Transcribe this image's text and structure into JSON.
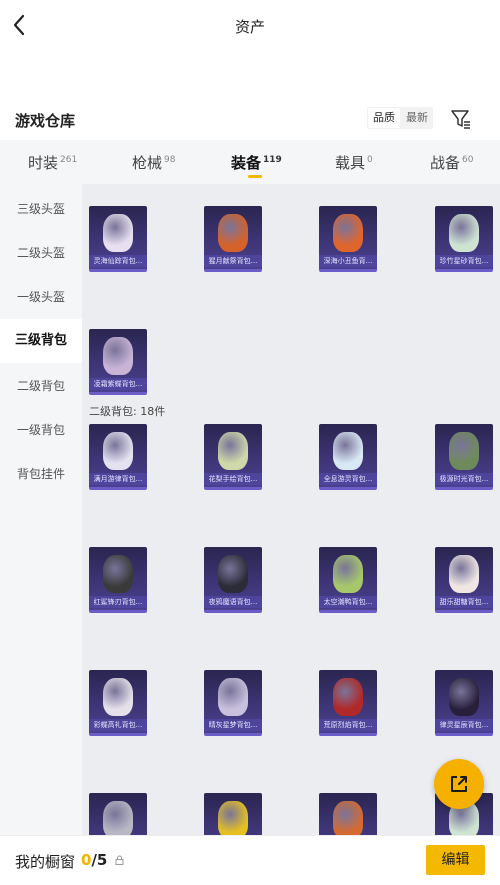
{
  "header": {
    "title": "资产"
  },
  "warehouse": {
    "title": "游戏仓库",
    "sort_options": [
      "品质",
      "最新"
    ],
    "sort_selected": "品质"
  },
  "tabs": [
    {
      "label": "时装",
      "count": "261"
    },
    {
      "label": "枪械",
      "count": "98"
    },
    {
      "label": "装备",
      "count": "119"
    },
    {
      "label": "载具",
      "count": "0"
    },
    {
      "label": "战备",
      "count": "60"
    }
  ],
  "active_tab": "装备",
  "sidebar": [
    "三级头盔",
    "二级头盔",
    "一级头盔",
    "三级背包",
    "二级背包",
    "一级背包",
    "背包挂件"
  ],
  "active_sidebar": "三级背包",
  "sections": [
    {
      "label": "",
      "items": [
        {
          "name": "灵海仙踪背包...",
          "color": "#e8e0f0"
        },
        {
          "name": "猩月献祭背包...",
          "color": "#d4622a"
        },
        {
          "name": "深海小丑鱼背...",
          "color": "#e0652c"
        },
        {
          "name": "珍竹星砂背包...",
          "color": "#cfe3d2"
        },
        {
          "name": "凌霜紫蝶背包...",
          "color": "#c9b4d6"
        }
      ]
    },
    {
      "label": "二级背包: 18件",
      "items": [
        {
          "name": "满月游律背包...",
          "color": "#e4e2f0"
        },
        {
          "name": "花梨手绘背包...",
          "color": "#cfd8a8"
        },
        {
          "name": "全息游灵背包...",
          "color": "#d8e8f4"
        },
        {
          "name": "极源时光背包...",
          "color": "#6f8a5a"
        },
        {
          "name": "红鲨锋刃背包...",
          "color": "#3a3a3a"
        },
        {
          "name": "夜鸦魔语背包...",
          "color": "#2c2c38"
        },
        {
          "name": "太空潮鸭背包...",
          "color": "#a6c86a"
        },
        {
          "name": "甜乐甜糖背包...",
          "color": "#f0e6e4"
        },
        {
          "name": "彩蝶高礼背包...",
          "color": "#e6e0ea"
        },
        {
          "name": "晴灰星梦背包...",
          "color": "#c8c0dc"
        },
        {
          "name": "荒原烈焰背包...",
          "color": "#b02828"
        },
        {
          "name": "律灵星辰背包...",
          "color": "#28203a"
        },
        {
          "name": "",
          "color": "#b8b8c4"
        },
        {
          "name": "",
          "color": "#e6c020"
        },
        {
          "name": "",
          "color": "#d46a30"
        },
        {
          "name": "",
          "color": "#cfe3d2"
        }
      ]
    }
  ],
  "bottom_bar": {
    "label": "我的橱窗",
    "current": "0",
    "total": "/5",
    "lock_icon": "lock-icon",
    "edit_label": "编辑"
  },
  "colors": {
    "accent": "#f5b800",
    "tab_bg": "#f4f6f8",
    "content_bg": "#ebedf1",
    "item_card": "#3d3575"
  }
}
